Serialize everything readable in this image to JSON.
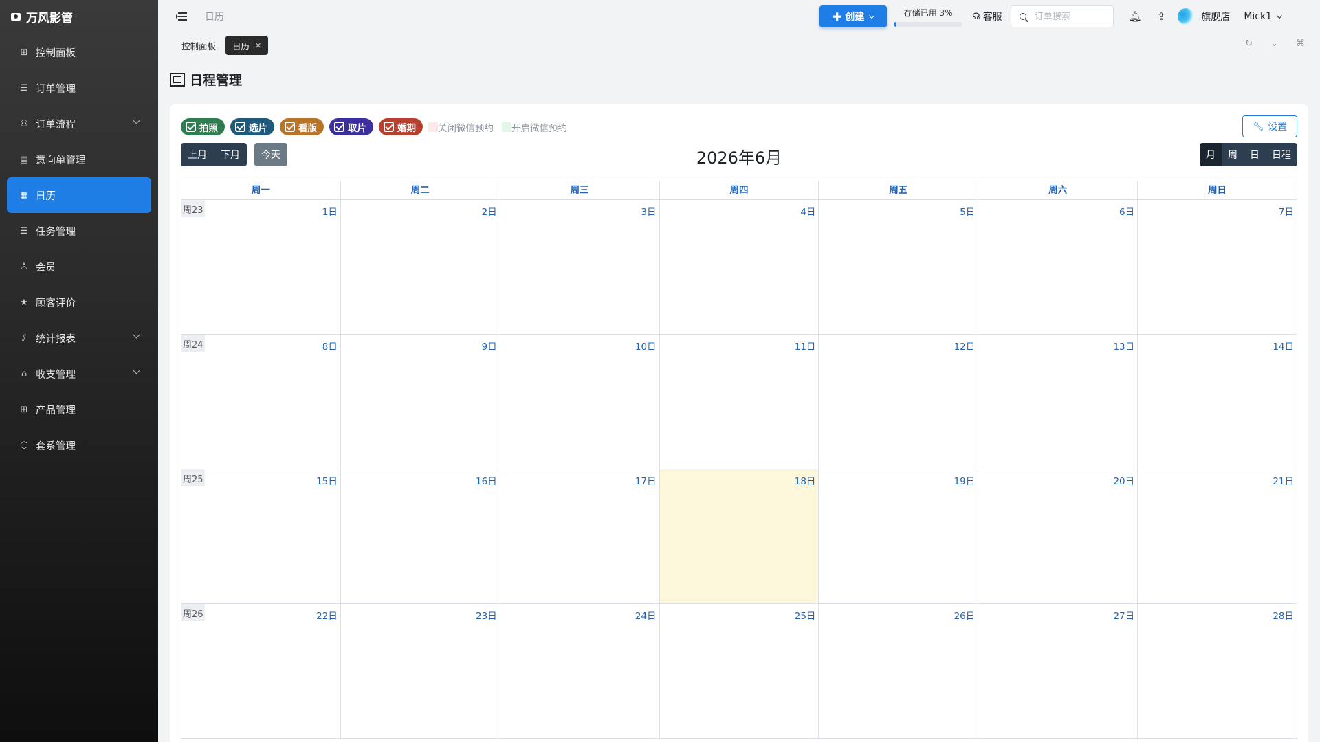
{
  "app": {
    "brand": "万风影管"
  },
  "sidebar": {
    "items": [
      {
        "label": "控制面板",
        "icon": "grid-icon",
        "glyph": "⊞"
      },
      {
        "label": "订单管理",
        "icon": "list-icon",
        "glyph": "☰"
      },
      {
        "label": "订单流程",
        "icon": "flow-icon",
        "glyph": "⚇"
      },
      {
        "label": "意向单管理",
        "icon": "clipboard-icon",
        "glyph": "▤"
      },
      {
        "label": "日历",
        "icon": "calendar-icon",
        "glyph": "▦"
      },
      {
        "label": "任务管理",
        "icon": "tasks-icon",
        "glyph": "☰"
      },
      {
        "label": "会员",
        "icon": "user-icon",
        "glyph": "♙"
      },
      {
        "label": "顾客评价",
        "icon": "star-icon",
        "glyph": "★"
      },
      {
        "label": "统计报表",
        "icon": "chart-icon",
        "glyph": "⫽"
      },
      {
        "label": "收支管理",
        "icon": "bank-icon",
        "glyph": "⌂"
      },
      {
        "label": "产品管理",
        "icon": "apps-icon",
        "glyph": "⊞"
      },
      {
        "label": "套系管理",
        "icon": "package-icon",
        "glyph": "⬡"
      }
    ],
    "active_index": 4,
    "expandable": [
      2,
      8,
      9
    ]
  },
  "header": {
    "breadcrumb": "日历",
    "create_label": "创建",
    "storage_label": "存储已用 3%",
    "storage_percent": 3,
    "service_label": "客服",
    "search_placeholder": "订单搜索",
    "shop_name": "旗舰店",
    "user_name": "Mick1"
  },
  "tabs": [
    {
      "label": "控制面板"
    },
    {
      "label": "日历"
    }
  ],
  "page": {
    "title": "日程管理"
  },
  "legend": {
    "chips": [
      {
        "label": "拍照",
        "color": "#2e7d4f"
      },
      {
        "label": "选片",
        "color": "#1f5a7a"
      },
      {
        "label": "看版",
        "color": "#b8752a"
      },
      {
        "label": "取片",
        "color": "#3a2f9c"
      },
      {
        "label": "婚期",
        "color": "#b8402f"
      }
    ],
    "closed_wechat": {
      "label": "关闭微信预约",
      "color": "#fde9e9"
    },
    "open_wechat": {
      "label": "开启微信预约",
      "color": "#e3f7e6"
    }
  },
  "toolbar": {
    "settings_label": "设置",
    "prev_label": "上月",
    "next_label": "下月",
    "today_label": "今天",
    "month_title": "2026年6月",
    "views": [
      "月",
      "周",
      "日",
      "日程"
    ],
    "active_view": 0
  },
  "calendar": {
    "weekdays": [
      "周一",
      "周二",
      "周三",
      "周四",
      "周五",
      "周六",
      "周日"
    ],
    "weeks": [
      {
        "label": "周23",
        "days": [
          "1日",
          "2日",
          "3日",
          "4日",
          "5日",
          "6日",
          "7日"
        ]
      },
      {
        "label": "周24",
        "days": [
          "8日",
          "9日",
          "10日",
          "11日",
          "12日",
          "13日",
          "14日"
        ]
      },
      {
        "label": "周25",
        "days": [
          "15日",
          "16日",
          "17日",
          "18日",
          "19日",
          "20日",
          "21日"
        ]
      },
      {
        "label": "周26",
        "days": [
          "22日",
          "23日",
          "24日",
          "25日",
          "26日",
          "27日",
          "28日"
        ]
      }
    ],
    "today": "18日"
  }
}
